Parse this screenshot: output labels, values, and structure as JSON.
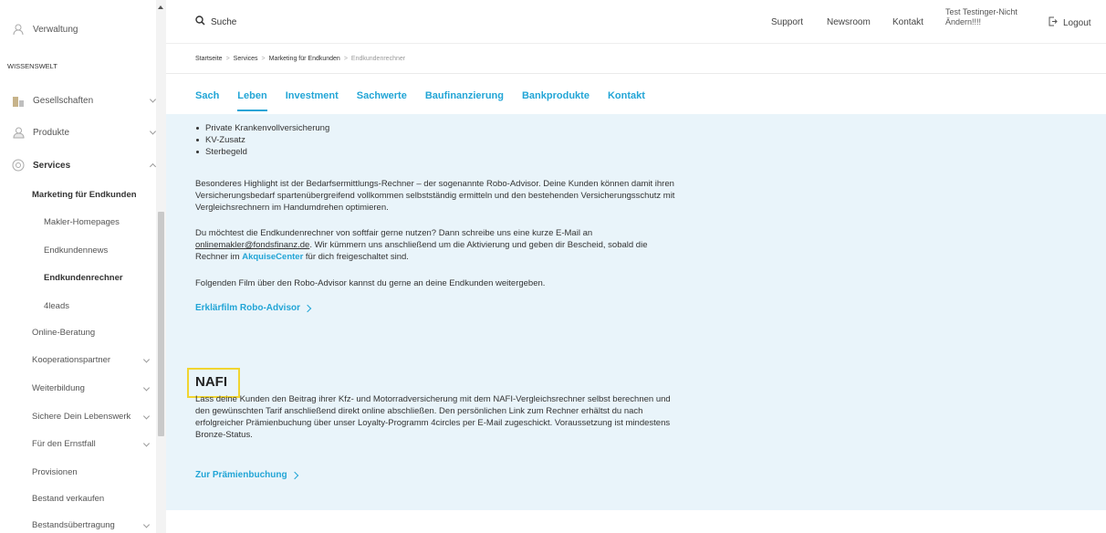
{
  "sidebar": {
    "top_item": "Verwaltung",
    "section_label": "WISSENSWELT",
    "items": [
      {
        "label": "Gesellschaften"
      },
      {
        "label": "Produkte"
      },
      {
        "label": "Services"
      },
      {
        "label": "Marketing für Endkunden"
      },
      {
        "label": "Makler-Homepages"
      },
      {
        "label": "Endkundennews"
      },
      {
        "label": "Endkundenrechner"
      },
      {
        "label": "4leads"
      },
      {
        "label": "Online-Beratung"
      },
      {
        "label": "Kooperationspartner"
      },
      {
        "label": "Weiterbildung"
      },
      {
        "label": "Sichere Dein Lebenswerk"
      },
      {
        "label": "Für den Ernstfall"
      },
      {
        "label": "Provisionen"
      },
      {
        "label": "Bestand verkaufen"
      },
      {
        "label": "Bestandsübertragung"
      }
    ]
  },
  "topbar": {
    "search_placeholder": "Suche",
    "links": {
      "support": "Support",
      "newsroom": "Newsroom",
      "kontakt": "Kontakt"
    },
    "user_name": "Test Testinger-Nicht Ändern!!!!",
    "logout": "Logout"
  },
  "breadcrumb": [
    "Startseite",
    "Services",
    "Marketing für Endkunden",
    "Endkundenrechner"
  ],
  "tabs": [
    {
      "label": "Sach"
    },
    {
      "label": "Leben"
    },
    {
      "label": "Investment"
    },
    {
      "label": "Sachwerte"
    },
    {
      "label": "Baufinanzierung"
    },
    {
      "label": "Bankprodukte"
    },
    {
      "label": "Kontakt"
    }
  ],
  "content": {
    "bullets": [
      "Private Krankenvollversicherung",
      "KV-Zusatz",
      "Sterbegeld"
    ],
    "para1": "Besonderes Highlight ist der Bedarfsermittlungs-Rechner – der sogenannte Robo-Advisor. Deine Kunden können damit ihren Versicherungsbedarf spartenübergreifend vollkommen selbstständig ermitteln und den bestehenden Versicherungsschutz mit Vergleichsrechnern im Handumdrehen optimieren.",
    "para2_a": "Du möchtest die Endkundenrechner von softfair gerne nutzen? Dann schreibe uns eine kurze E-Mail an ",
    "para2_email": "onlinemakler@fondsfinanz.de",
    "para2_b": ". Wir kümmern uns anschließend um die Aktivierung und geben dir Bescheid, sobald die Rechner im ",
    "para2_link": "AkquiseCenter",
    "para2_c": " für dich freigeschaltet sind.",
    "para3": "Folgenden Film über den Robo-Advisor kannst du gerne an deine Endkunden weitergeben.",
    "video_link": "Erklärfilm Robo-Advisor",
    "nafi_title": "NAFI",
    "nafi_text": "Lass deine Kunden den Beitrag ihrer Kfz- und Motorradversicherung mit dem NAFI-Vergleichsrechner selbst berechnen und den gewünschten Tarif anschließend direkt online abschließen. Den persönlichen Link zum Rechner erhältst du nach erfolgreicher Prämienbuchung über unser Loyalty-Programm 4circles per E-Mail zugeschickt. Voraussetzung ist mindestens Bronze-Status.",
    "nafi_link": "Zur Prämienbuchung"
  },
  "colors": {
    "accent": "#22a5d6",
    "panel": "#e9f4fa",
    "highlight": "#f1d530"
  }
}
